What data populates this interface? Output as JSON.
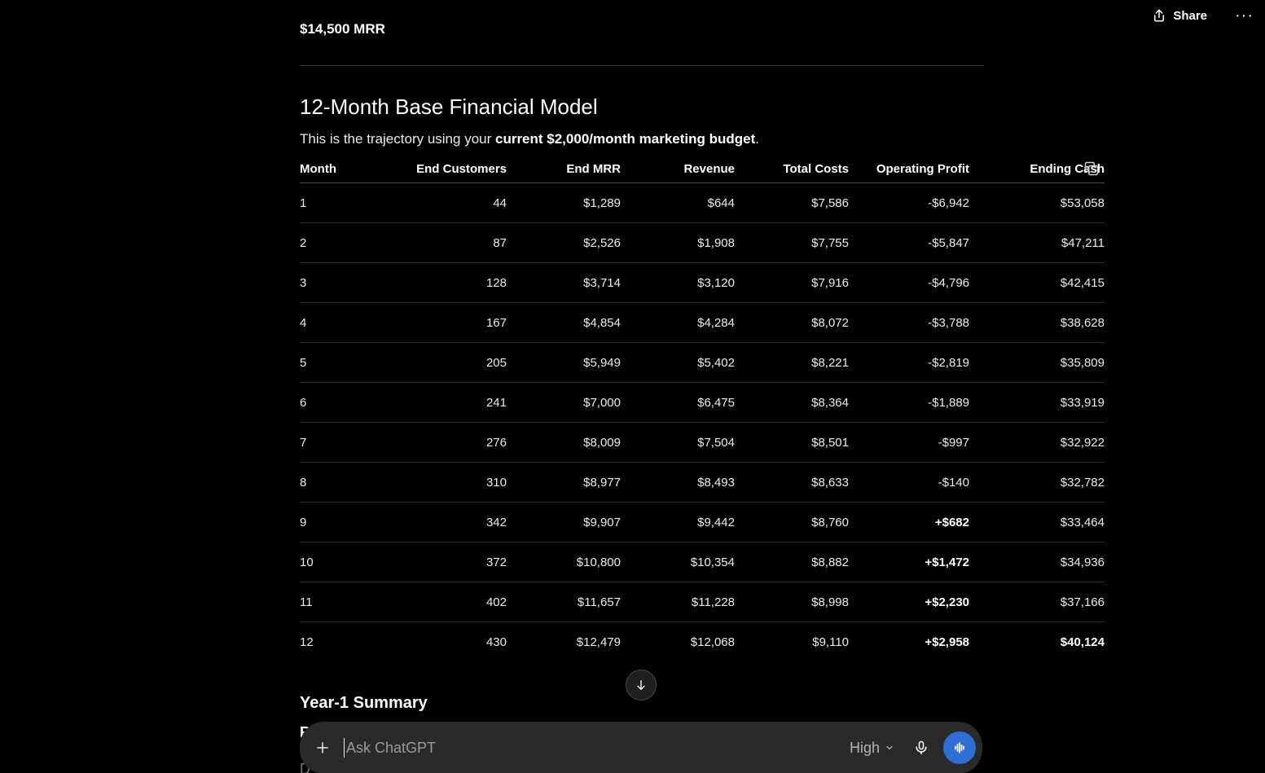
{
  "header": {
    "share_label": "Share",
    "more_label": "···"
  },
  "cut_text": "...................",
  "mrr_line": "$14,500 MRR",
  "section": {
    "title": "12-Month Base Financial Model",
    "intro_prefix": "This is the trajectory using your ",
    "intro_bold": "current $2,000/month marketing budget",
    "intro_suffix": "."
  },
  "table": {
    "headers": [
      "Month",
      "End Customers",
      "End MRR",
      "Revenue",
      "Total Costs",
      "Operating Profit",
      "Ending Cash"
    ],
    "rows": [
      [
        "1",
        "44",
        "$1,289",
        "$644",
        "$7,586",
        "-$6,942",
        "$53,058"
      ],
      [
        "2",
        "87",
        "$2,526",
        "$1,908",
        "$7,755",
        "-$5,847",
        "$47,211"
      ],
      [
        "3",
        "128",
        "$3,714",
        "$3,120",
        "$7,916",
        "-$4,796",
        "$42,415"
      ],
      [
        "4",
        "167",
        "$4,854",
        "$4,284",
        "$8,072",
        "-$3,788",
        "$38,628"
      ],
      [
        "5",
        "205",
        "$5,949",
        "$5,402",
        "$8,221",
        "-$2,819",
        "$35,809"
      ],
      [
        "6",
        "241",
        "$7,000",
        "$6,475",
        "$8,364",
        "-$1,889",
        "$33,919"
      ],
      [
        "7",
        "276",
        "$8,009",
        "$7,504",
        "$8,501",
        "-$997",
        "$32,922"
      ],
      [
        "8",
        "310",
        "$8,977",
        "$8,493",
        "$8,633",
        "-$140",
        "$32,782"
      ],
      [
        "9",
        "342",
        "$9,907",
        "$9,442",
        "$8,760",
        "+$682",
        "$33,464"
      ],
      [
        "10",
        "372",
        "$10,800",
        "$10,354",
        "$8,882",
        "+$1,472",
        "$34,936"
      ],
      [
        "11",
        "402",
        "$11,657",
        "$11,228",
        "$8,998",
        "+$2,230",
        "$37,166"
      ],
      [
        "12",
        "430",
        "$12,479",
        "$12,068",
        "$9,110",
        "+$2,958",
        "$40,124"
      ]
    ]
  },
  "summary_title": "Year-1 Summary",
  "peek_text_1": "R",
  "peek_text_2": "D",
  "composer": {
    "placeholder": "Ask ChatGPT",
    "model_label": "High"
  },
  "icons": {
    "share": "share-icon",
    "copy": "copy-icon",
    "scroll": "arrow-down-icon",
    "plus": "plus-icon",
    "chevron": "chevron-down-icon",
    "mic": "microphone-icon",
    "voice": "voice-waveform-icon"
  },
  "colors": {
    "background": "#000000",
    "text": "#ececec",
    "composer_bg": "#2a2a2a",
    "voice_button": "#2f6ed4"
  }
}
